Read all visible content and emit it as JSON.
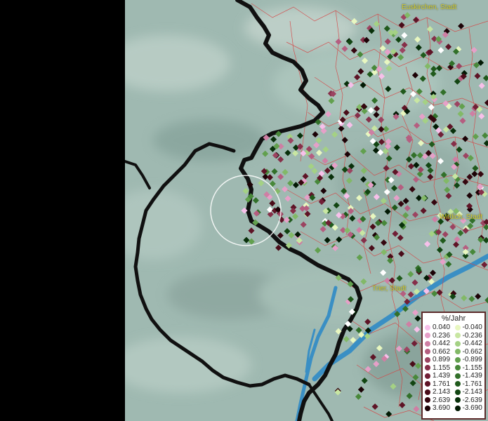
{
  "cities": {
    "euskirchen": "Euskirchen, Stadt",
    "wittlich": "Wittlich, Stadt",
    "trier": "Trier, Stadt"
  },
  "legend": {
    "title": "%/Jahr",
    "positive": [
      {
        "label": "0.040",
        "color": "#f7c0ea"
      },
      {
        "label": "0.236",
        "color": "#e6a0c8"
      },
      {
        "label": "0.442",
        "color": "#cf7fa4"
      },
      {
        "label": "0.662",
        "color": "#b55e80"
      },
      {
        "label": "0.899",
        "color": "#9c4461"
      },
      {
        "label": "1.155",
        "color": "#862f49"
      },
      {
        "label": "1.439",
        "color": "#711f36"
      },
      {
        "label": "1.761",
        "color": "#5e1426"
      },
      {
        "label": "2.143",
        "color": "#4a0c19"
      },
      {
        "label": "2.639",
        "color": "#35060f"
      },
      {
        "label": "3.690",
        "color": "#1c0206"
      }
    ],
    "negative": [
      {
        "label": "-0.040",
        "color": "#e8f7c0"
      },
      {
        "label": "-0.236",
        "color": "#c8e6a2"
      },
      {
        "label": "-0.442",
        "color": "#a4d184"
      },
      {
        "label": "-0.662",
        "color": "#82b967"
      },
      {
        "label": "-0.899",
        "color": "#62a04e"
      },
      {
        "label": "-1.155",
        "color": "#48883a"
      },
      {
        "label": "-1.439",
        "color": "#32702a"
      },
      {
        "label": "-1.761",
        "color": "#205a1c"
      },
      {
        "label": "-2.143",
        "color": "#124512"
      },
      {
        "label": "-2.639",
        "color": "#08300a"
      },
      {
        "label": "-3.690",
        "color": "#021a04"
      }
    ]
  },
  "colors": {
    "terrain": "#9fb9b1",
    "borders": "#101010",
    "district_lines": "#d64545",
    "river": "#3a8fc4",
    "label": "#d6cc2a"
  }
}
